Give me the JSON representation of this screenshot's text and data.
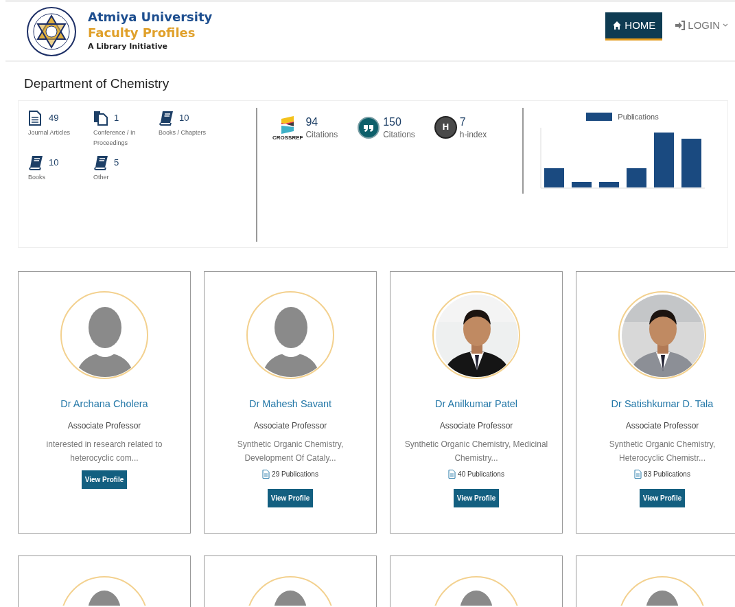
{
  "header": {
    "title": "Atmiya University",
    "subtitle": "Faculty Profiles",
    "tagline": "A Library Initiative"
  },
  "nav": [
    {
      "label": "HOME",
      "kind": "home",
      "selected": true,
      "caret": false
    },
    {
      "label": "LOGIN",
      "kind": "login",
      "selected": false,
      "caret": true
    }
  ],
  "department": "Department of Chemistry",
  "publication_stats": [
    {
      "kind": "document",
      "value": "49",
      "label": "Journal Articles"
    },
    {
      "kind": "copy",
      "value": "1",
      "label": "Conference / In Proceedings"
    },
    {
      "kind": "book",
      "value": "10",
      "label": "Books / Chapters"
    },
    {
      "kind": "book",
      "value": "10",
      "label": "Books"
    },
    {
      "kind": "book",
      "value": "5",
      "label": "Other"
    }
  ],
  "citation_stats": [
    {
      "kind": "crossref",
      "logo_text": "CROSSREF",
      "value": "94",
      "label": "Citations"
    },
    {
      "kind": "quote",
      "value": "150",
      "label": "Citations"
    },
    {
      "kind": "h",
      "icon_text": "H",
      "value": "7",
      "label": "h-index"
    }
  ],
  "chart": {
    "legend": "Publications"
  },
  "faculty": [
    {
      "kind": "avatar",
      "name": "Dr Archana Cholera",
      "designation": "Associate Professor",
      "interests": "interested in research related to heterocyclic com...",
      "button": "View Profile"
    },
    {
      "kind": "avatar",
      "name": "Dr Mahesh Savant",
      "designation": "Associate Professor",
      "interests": "Synthetic Organic Chemistry, Development Of Cataly...",
      "publications": "29 Publications",
      "button": "View Profile"
    },
    {
      "kind": "picture",
      "name": "Dr Anilkumar Patel",
      "designation": "Associate Professor",
      "interests": "Synthetic Organic Chemistry, Medicinal Chemistry...",
      "publications": "40 Publications",
      "button": "View Profile"
    },
    {
      "kind": "picture",
      "name": "Dr Satishkumar D. Tala",
      "designation": "Associate Professor",
      "interests": "Synthetic Organic Chemistry, Heterocyclic Chemistr...",
      "publications": "83 Publications",
      "button": "View Profile"
    },
    {
      "kind": "avatar"
    },
    {
      "kind": "avatar"
    },
    {
      "kind": "avatar"
    },
    {
      "kind": "avatar"
    }
  ]
}
